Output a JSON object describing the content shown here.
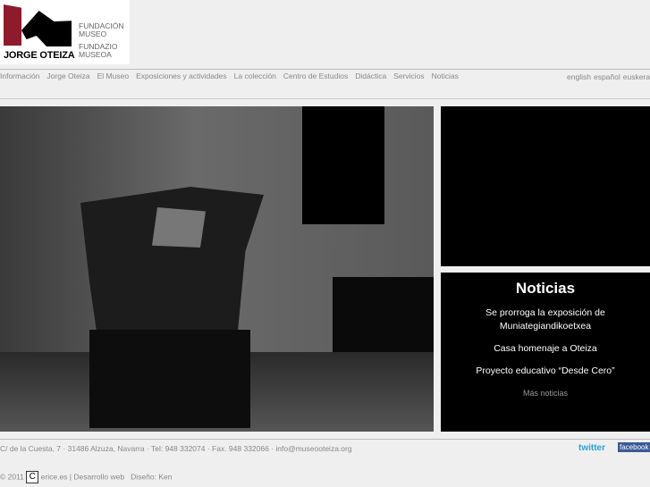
{
  "logo": {
    "name": "JORGE OTEIZA",
    "line1": "FUNDACIÓN",
    "line2": "MUSEO",
    "line3": "FUNDAZIO",
    "line4": "MUSEOA"
  },
  "nav": [
    "Información",
    "Jorge Oteiza",
    "El Museo",
    "Exposiciones y actividades",
    "La colección",
    "Centro de Estudios",
    "Didáctica",
    "Servicios",
    "Noticias"
  ],
  "languages": [
    "english",
    "español",
    "euskera"
  ],
  "news": {
    "title": "Noticias",
    "items": [
      "Se prorroga la exposición de Muniategiandikoetxea",
      "Casa homenaje a Oteiza",
      "Proyecto educativo “Desde Cero”"
    ],
    "more": "Más noticias"
  },
  "footer": {
    "address": "C/ de la Cuesta, 7 · 31486 Alzuza, Navarra · Tel: 948 332074 · Fax. 948 332066 · info@museooteiza.org",
    "copyright": "© 2011",
    "credit_logo": "C",
    "credit": "erice.es | Desarrollo web",
    "design": "Diseño: Ken",
    "twitter": "twitter",
    "facebook": "facebook"
  }
}
